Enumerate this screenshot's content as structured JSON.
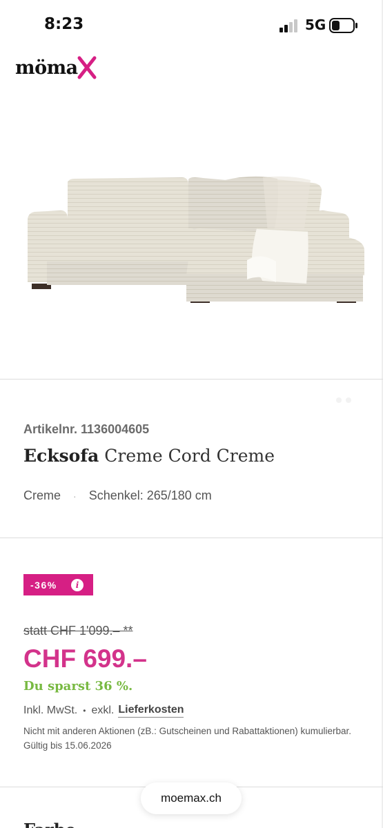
{
  "status_bar": {
    "time": "8:23",
    "network": "5G",
    "icons": [
      "signal-bars-icon",
      "battery-icon"
    ]
  },
  "header": {
    "logo_text": "möma",
    "logo_mark": "X",
    "brand_colors": {
      "logo_x": "#d61f84",
      "text": "#111111"
    }
  },
  "product": {
    "image_alt": "Ecksofa Creme Cord Creme",
    "sku": "Artikelnr. 1136004605",
    "title_bold": "Ecksofa",
    "title_rest": " Creme Cord Creme",
    "attributes": [
      "Creme",
      "Schenkel: 265/180 cm"
    ],
    "attribute_separator": "·"
  },
  "pricing": {
    "discount_badge": "-36%",
    "info_icon": "i",
    "old_price": "statt CHF 1'099.– **",
    "new_price": "CHF 699.–",
    "savings": "Du sparst 36 %.",
    "tax_label": "Inkl. MwSt.",
    "tax_separator": "•",
    "shipping_prefix": "exkl.",
    "shipping_link": "Lieferkosten",
    "notice": "Nicht mit anderen Aktionen (zB.: Gutscheinen und Rabattaktionen) kumulierbar. Gültig bis 15.06.2026",
    "colors": {
      "badge": "#d61f84",
      "price": "#d3338b",
      "savings": "#78b942"
    }
  },
  "browser": {
    "url": "moemax.ch"
  },
  "next_section": {
    "heading": "Farbe"
  }
}
